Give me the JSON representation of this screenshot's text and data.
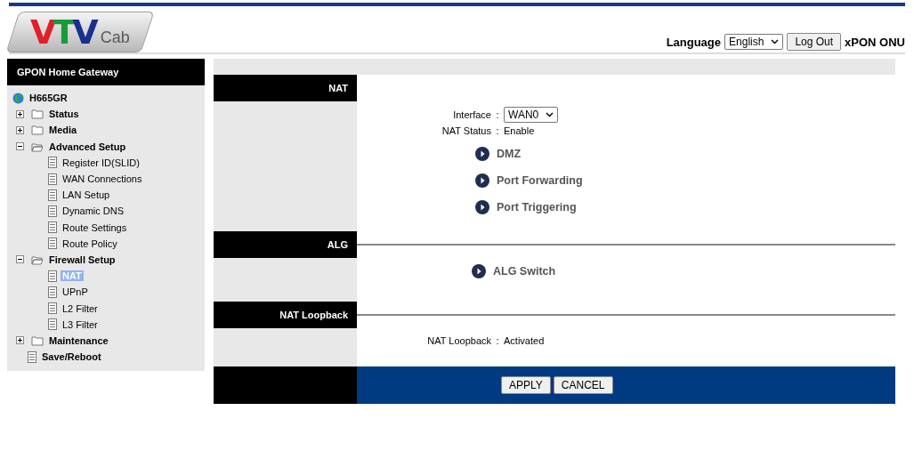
{
  "logo": {
    "letters": [
      {
        "text": "V",
        "color": "#e0202a"
      },
      {
        "text": "T",
        "color": "#1a9a3a"
      },
      {
        "text": "V",
        "color": "#1a2f8f"
      }
    ],
    "suffix": "Cab"
  },
  "header": {
    "language_label": "Language",
    "language": "English",
    "logout": "Log Out",
    "product": "xPON ONU"
  },
  "sidebar": {
    "title": "GPON Home Gateway",
    "root": "H665GR",
    "items": [
      {
        "label": "Status",
        "kind": "folder",
        "expanded": false
      },
      {
        "label": "Media",
        "kind": "folder",
        "expanded": false
      },
      {
        "label": "Advanced Setup",
        "kind": "folder",
        "expanded": true,
        "children": [
          {
            "label": "Register ID(SLID)",
            "selected": false
          },
          {
            "label": "WAN Connections",
            "selected": false
          },
          {
            "label": "LAN Setup",
            "selected": false
          },
          {
            "label": "Dynamic DNS",
            "selected": false
          },
          {
            "label": "Route Settings",
            "selected": false
          },
          {
            "label": "Route Policy",
            "selected": false
          }
        ]
      },
      {
        "label": "Firewall Setup",
        "kind": "folder",
        "expanded": true,
        "children": [
          {
            "label": "NAT",
            "selected": true
          },
          {
            "label": "UPnP",
            "selected": false
          },
          {
            "label": "L2 Filter",
            "selected": false
          },
          {
            "label": "L3 Filter",
            "selected": false
          }
        ]
      },
      {
        "label": "Maintenance",
        "kind": "folder",
        "expanded": false
      },
      {
        "label": "Save/Reboot",
        "kind": "page"
      }
    ]
  },
  "sections": [
    {
      "title": "NAT",
      "fields": [
        {
          "label": "Interface",
          "separator": ":",
          "kind": "select",
          "value": "WAN0"
        },
        {
          "label": "NAT Status",
          "separator": ":",
          "kind": "text",
          "value": "Enable"
        }
      ],
      "links": [
        "DMZ",
        "Port Forwarding",
        "Port Triggering"
      ]
    },
    {
      "title": "ALG",
      "links": [
        "ALG Switch"
      ]
    },
    {
      "title": "NAT Loopback",
      "fields": [
        {
          "label": "NAT Loopback",
          "separator": ":",
          "kind": "text",
          "value": "Activated"
        }
      ]
    }
  ],
  "buttons": [
    "APPLY",
    "CANCEL"
  ]
}
